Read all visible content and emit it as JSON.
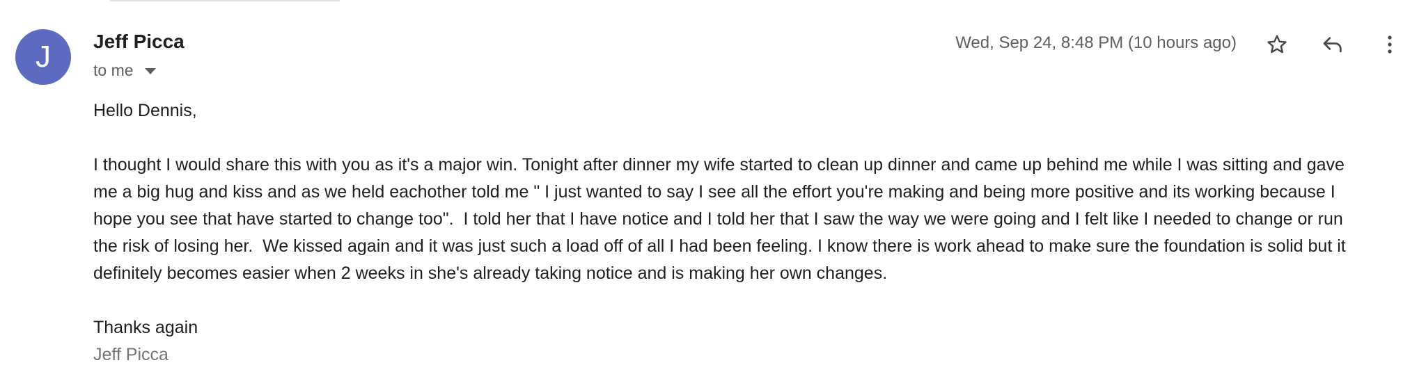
{
  "email": {
    "sender": {
      "name": "Jeff Picca",
      "avatar_initial": "J",
      "avatar_color": "#5c6bc0"
    },
    "recipient_label": "to me",
    "timestamp": "Wed, Sep 24, 8:48 PM (10 hours ago)",
    "actions": {
      "star_icon": "star-outline-icon",
      "reply_icon": "reply-icon",
      "more_icon": "more-vert-icon"
    },
    "body": {
      "greeting": "Hello Dennis,",
      "paragraph_lines": [
        "I thought I would share this with you as it's a major win. Tonight after dinner my wife started to clean up dinner and came up behind me while I was sitting and gave",
        "me a big hug and kiss and as we held eachother told me \" I just wanted to say I see all the effort you're making and being more positive and its working because I",
        "hope you see that have started to change too\".  I told her that I have notice and I told her that I saw the way we were going and I felt like I needed to change or run",
        "the risk of losing her.  We kissed again and it was just such a load off of all I had been feeling. I know there is work ahead to make sure the foundation is solid but it",
        "definitely becomes easier when 2 weeks in she's already taking notice and is making her own changes."
      ],
      "closing": "Thanks again",
      "signature": "Jeff Picca"
    }
  }
}
